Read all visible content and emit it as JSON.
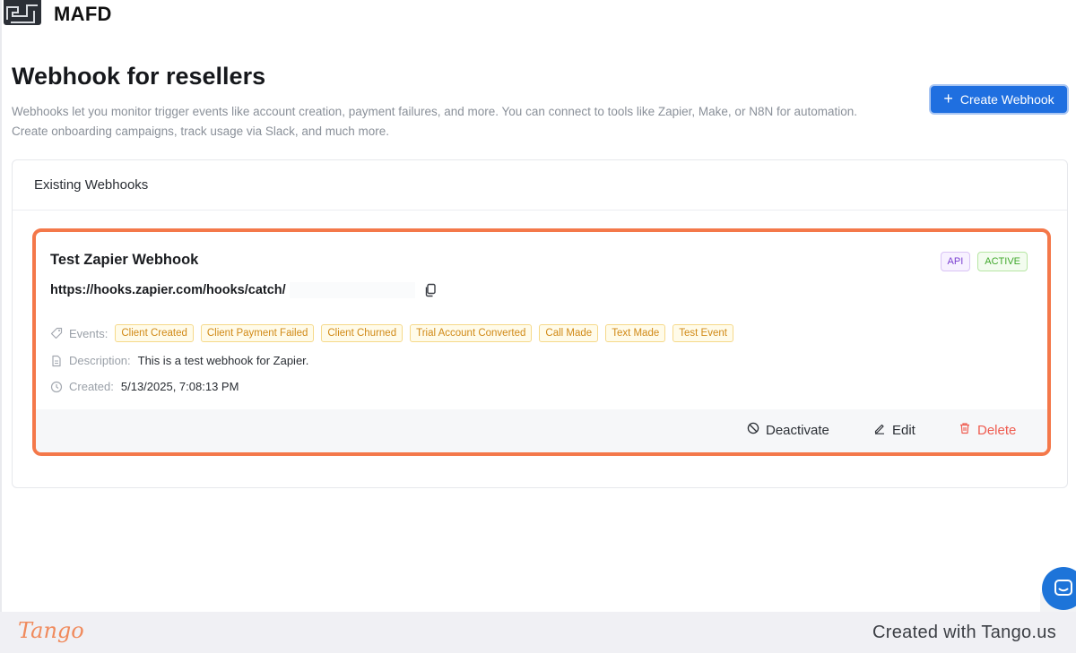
{
  "app": {
    "brand": "MAFD"
  },
  "header": {
    "title": "Webhook for resellers",
    "description_line1": "Webhooks let you monitor trigger events like account creation, payment failures, and more. You can connect to tools like Zapier, Make, or N8N for automation.",
    "description_line2": "Create onboarding campaigns, track usage via Slack, and much more.",
    "create_button": "Create Webhook"
  },
  "panel": {
    "title": "Existing Webhooks",
    "webhook": {
      "name": "Test Zapier Webhook",
      "url": "https://hooks.zapier.com/hooks/catch/",
      "badges": {
        "api": "API",
        "status": "ACTIVE"
      },
      "events_label": "Events:",
      "events": [
        "Client Created",
        "Client Payment Failed",
        "Client Churned",
        "Trial Account Converted",
        "Call Made",
        "Text Made",
        "Test Event"
      ],
      "description_label": "Description:",
      "description": "This is a test webhook for Zapier.",
      "created_label": "Created:",
      "created": "5/13/2025, 7:08:13 PM",
      "actions": {
        "deactivate": "Deactivate",
        "edit": "Edit",
        "delete": "Delete"
      }
    }
  },
  "footer": {
    "logo": "Tango",
    "credit": "Created with Tango.us"
  },
  "colors": {
    "accent": "#1f6fe0",
    "highlight": "#f4784a",
    "delete": "#ef5b4f"
  }
}
